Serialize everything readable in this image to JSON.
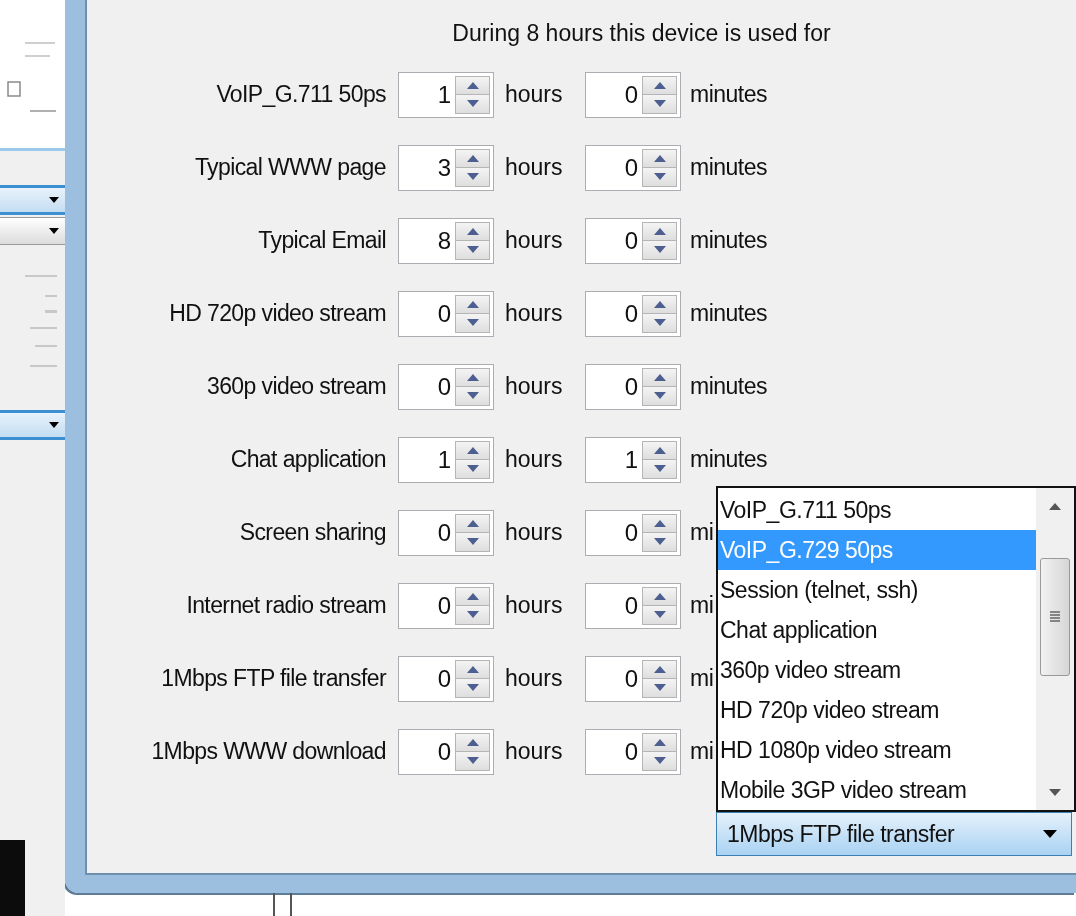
{
  "title": "During 8 hours this device is used for",
  "rows": [
    {
      "label": "VoIP_G.711 50ps",
      "hours": "1",
      "hours_unit": "hours",
      "minutes": "0",
      "minutes_unit": "minutes"
    },
    {
      "label": "Typical WWW page",
      "hours": "3",
      "hours_unit": "hours",
      "minutes": "0",
      "minutes_unit": "minutes"
    },
    {
      "label": "Typical Email",
      "hours": "8",
      "hours_unit": "hours",
      "minutes": "0",
      "minutes_unit": "minutes"
    },
    {
      "label": "HD 720p video stream",
      "hours": "0",
      "hours_unit": "hours",
      "minutes": "0",
      "minutes_unit": "minutes"
    },
    {
      "label": "360p video stream",
      "hours": "0",
      "hours_unit": "hours",
      "minutes": "0",
      "minutes_unit": "minutes"
    },
    {
      "label": "Chat application",
      "hours": "1",
      "hours_unit": "hours",
      "minutes": "1",
      "minutes_unit": "minutes"
    },
    {
      "label": "Screen sharing",
      "hours": "0",
      "hours_unit": "hours",
      "minutes": "0",
      "minutes_unit": "mi"
    },
    {
      "label": "Internet radio stream",
      "hours": "0",
      "hours_unit": "hours",
      "minutes": "0",
      "minutes_unit": "mi"
    },
    {
      "label": "1Mbps FTP file transfer",
      "hours": "0",
      "hours_unit": "hours",
      "minutes": "0",
      "minutes_unit": "mi"
    },
    {
      "label": "1Mbps WWW download",
      "hours": "0",
      "hours_unit": "hours",
      "minutes": "0",
      "minutes_unit": "mi"
    }
  ],
  "dropdown": {
    "value": "1Mbps FTP file transfer",
    "items": [
      {
        "label": "VoIP_G.711 50ps",
        "selected": false
      },
      {
        "label": "VoIP_G.729 50ps",
        "selected": true
      },
      {
        "label": "Session (telnet, ssh)",
        "selected": false
      },
      {
        "label": "Chat application",
        "selected": false
      },
      {
        "label": "360p video stream",
        "selected": false
      },
      {
        "label": "HD 720p video stream",
        "selected": false
      },
      {
        "label": "HD 1080p video stream",
        "selected": false
      },
      {
        "label": "Mobile 3GP video stream",
        "selected": false
      }
    ]
  }
}
